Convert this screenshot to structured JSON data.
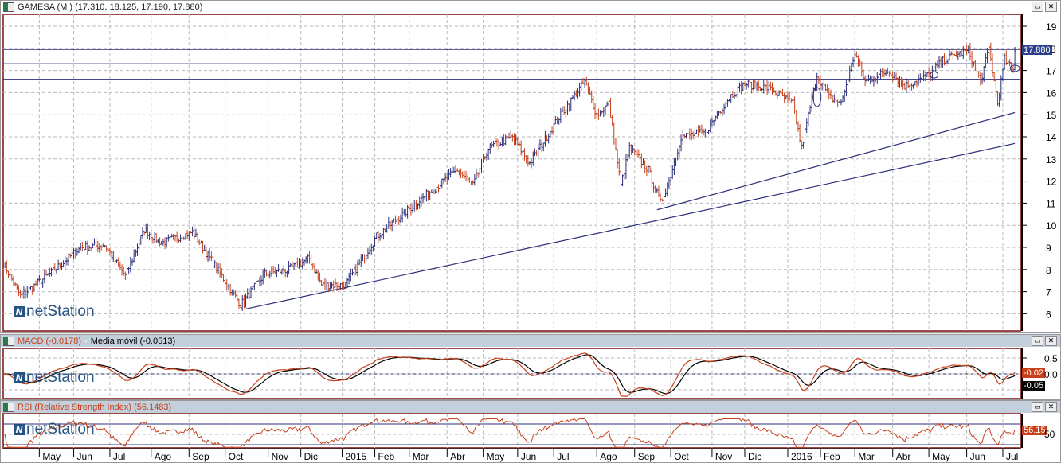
{
  "main": {
    "title": "GAMESA (M ) (17.310, 18.125, 17.190, 17.880)",
    "last_price_tag": "17.880",
    "logo": "netStation"
  },
  "macd": {
    "title_macd": "MACD (-0.0178)",
    "title_sep": " - ",
    "title_ma": "Media móvil (-0.0513)",
    "tag_macd": "-0.02",
    "tag_ma": "-0.05",
    "axis": [
      "0.5",
      "0.0"
    ]
  },
  "rsi": {
    "title": "RSI (Relative Strength Index) (56.1483)",
    "tag": "56.15",
    "axis": [
      "50"
    ]
  },
  "buttons": {
    "maximize": "▭",
    "close": "✕"
  },
  "colors": {
    "up": "#2b2f7a",
    "down": "#c8401a",
    "line": "#2b2f7a",
    "frame": "#9a4a4a",
    "header": "#c3cfdb"
  },
  "chart_data": {
    "type": "ohlc",
    "yaxis": {
      "ticks": [
        19,
        18,
        17,
        16,
        15,
        14,
        13,
        12,
        11,
        10,
        9,
        8,
        7,
        6
      ],
      "range": [
        5.5,
        19.5
      ]
    },
    "x_labels": [
      [
        "May",
        21
      ],
      [
        "Jun",
        41
      ],
      [
        "Jul",
        62
      ],
      [
        "Ago",
        86
      ],
      [
        "Sep",
        108
      ],
      [
        "Oct",
        129
      ],
      [
        "Nov",
        154
      ],
      [
        "Dic",
        173
      ],
      [
        "2015",
        197
      ],
      [
        "Feb",
        216
      ],
      [
        "Mar",
        236
      ],
      [
        "Abr",
        258
      ],
      [
        "May",
        279
      ],
      [
        "Jun",
        299
      ],
      [
        "Jul",
        320
      ],
      [
        "Ago",
        345
      ],
      [
        "Sep",
        367
      ],
      [
        "Oct",
        388
      ],
      [
        "Nov",
        412
      ],
      [
        "Dic",
        431
      ],
      [
        "2016",
        456
      ],
      [
        "Feb",
        475
      ],
      [
        "Mar",
        495
      ],
      [
        "Abr",
        517
      ],
      [
        "May",
        538
      ],
      [
        "Jun",
        560
      ],
      [
        "Jul",
        581
      ]
    ],
    "price_path_day_close": [
      [
        0,
        8.3
      ],
      [
        10,
        6.8
      ],
      [
        27,
        7.8
      ],
      [
        45,
        9.0
      ],
      [
        59,
        9.1
      ],
      [
        71,
        7.7
      ],
      [
        82,
        9.8
      ],
      [
        92,
        9.2
      ],
      [
        110,
        9.7
      ],
      [
        133,
        7.0
      ],
      [
        138,
        6.4
      ],
      [
        152,
        7.8
      ],
      [
        166,
        8.0
      ],
      [
        178,
        8.5
      ],
      [
        185,
        7.3
      ],
      [
        199,
        7.3
      ],
      [
        217,
        9.5
      ],
      [
        240,
        11.0
      ],
      [
        264,
        12.5
      ],
      [
        273,
        11.8
      ],
      [
        282,
        13.5
      ],
      [
        296,
        14.0
      ],
      [
        306,
        12.8
      ],
      [
        324,
        15.0
      ],
      [
        338,
        16.5
      ],
      [
        345,
        15.0
      ],
      [
        352,
        15.5
      ],
      [
        359,
        11.8
      ],
      [
        364,
        13.5
      ],
      [
        375,
        12.5
      ],
      [
        382,
        11.0
      ],
      [
        387,
        12.0
      ],
      [
        394,
        14.0
      ],
      [
        408,
        14.2
      ],
      [
        422,
        15.8
      ],
      [
        431,
        16.4
      ],
      [
        445,
        16.2
      ],
      [
        459,
        15.5
      ],
      [
        464,
        13.5
      ],
      [
        473,
        16.8
      ],
      [
        480,
        15.8
      ],
      [
        487,
        15.5
      ],
      [
        495,
        17.8
      ],
      [
        501,
        16.5
      ],
      [
        515,
        17.0
      ],
      [
        524,
        16.3
      ],
      [
        538,
        16.8
      ],
      [
        547,
        17.5
      ],
      [
        561,
        17.9
      ],
      [
        568,
        16.5
      ],
      [
        573,
        18.0
      ],
      [
        578,
        15.5
      ],
      [
        582,
        17.5
      ],
      [
        587,
        17.0
      ],
      [
        588,
        17.88
      ]
    ],
    "horizontal_lines": [
      17.95,
      17.3,
      16.6
    ],
    "trendlines": [
      [
        [
          140,
          6.2
        ],
        [
          588,
          13.7
        ]
      ],
      [
        [
          380,
          10.7
        ],
        [
          588,
          15.1
        ]
      ]
    ],
    "macd_axis": [
      0.5,
      0.0
    ],
    "rsi_levels": [
      70,
      30
    ]
  }
}
